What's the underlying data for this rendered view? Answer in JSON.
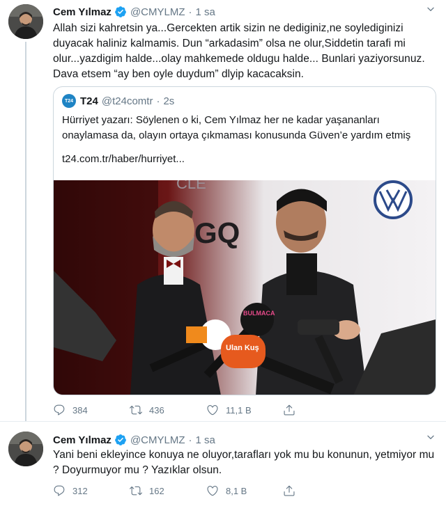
{
  "tweets": [
    {
      "author": {
        "name": "Cem Yılmaz",
        "handle": "@CMYLMZ",
        "time": "1 sa"
      },
      "text": "Allah sizi kahretsin ya...Gercekten artik  sizin ne dediginiz,ne soylediginizi duyacak haliniz kalmamis. Dun “arkadasim” olsa ne olur,Siddetin tarafi mi olur...yazdigim halde...olay mahkemede oldugu halde... Bunlari yaziyorsunuz. Dava etsem “ay ben oyle duydum” dlyip kacacaksin.",
      "quote": {
        "logo": "T24",
        "name": "T24",
        "handle": "@t24comtr",
        "time": "2s",
        "text": "Hürriyet yazarı: Söylenen o ki, Cem Yılmaz her ne kadar yaşananları onaylamasa da, olayın ortaya çıkmaması konusunda Güven’e yardım etmiş",
        "link": "t24.com.tr/haber/hurriyet...",
        "image_text": {
          "backdrop": "GQ",
          "backdrop_top": "CLE",
          "mic_red": "Ulan Kuş",
          "mic_black": "BULMACA"
        }
      },
      "stats": {
        "replies": "384",
        "retweets": "436",
        "likes": "11,1 B"
      }
    },
    {
      "author": {
        "name": "Cem Yılmaz",
        "handle": "@CMYLMZ",
        "time": "1 sa"
      },
      "text": "Yani beni ekleyince konuya ne oluyor,tarafları yok mu bu konunun, yetmiyor mu ? Doyurmuyor mu ? Yazıklar olsun.",
      "stats": {
        "replies": "312",
        "retweets": "162",
        "likes": "8,1 B"
      }
    }
  ],
  "separator": "·",
  "colors": {
    "verified": "#1da1f2",
    "muted": "#657786",
    "border": "#ccd6dd",
    "t24": "#1f84c4"
  },
  "icons": [
    "verified-badge-icon",
    "chevron-down-icon",
    "reply-icon",
    "retweet-icon",
    "like-icon",
    "share-icon"
  ]
}
